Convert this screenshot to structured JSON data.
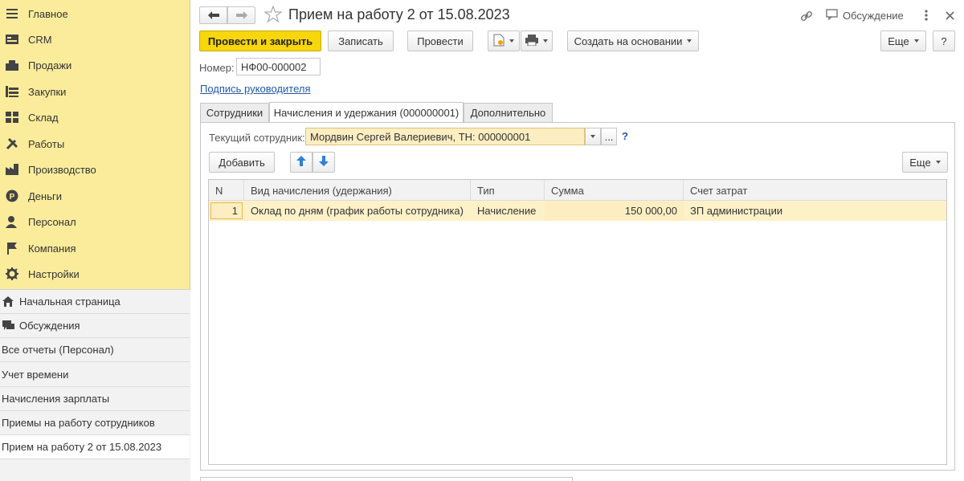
{
  "sidebar": {
    "sections": [
      {
        "label": "Главное",
        "icon": "menu-icon"
      },
      {
        "label": "CRM",
        "icon": "crm-icon"
      },
      {
        "label": "Продажи",
        "icon": "sales-icon"
      },
      {
        "label": "Закупки",
        "icon": "purchases-icon"
      },
      {
        "label": "Склад",
        "icon": "warehouse-icon"
      },
      {
        "label": "Работы",
        "icon": "tools-icon"
      },
      {
        "label": "Производство",
        "icon": "production-icon"
      },
      {
        "label": "Деньги",
        "icon": "money-icon"
      },
      {
        "label": "Персонал",
        "icon": "personnel-icon"
      },
      {
        "label": "Компания",
        "icon": "flag-icon"
      },
      {
        "label": "Настройки",
        "icon": "gear-icon"
      }
    ],
    "nav": [
      {
        "label": "Начальная страница",
        "icon": "home-icon"
      },
      {
        "label": "Обсуждения",
        "icon": "chat-icon"
      },
      {
        "label": "Все отчеты (Персонал)",
        "icon": ""
      },
      {
        "label": "Учет времени",
        "icon": ""
      },
      {
        "label": "Начисления зарплаты",
        "icon": ""
      },
      {
        "label": "Приемы на работу сотрудников",
        "icon": ""
      },
      {
        "label": "Прием на работу 2 от 15.08.2023",
        "icon": ""
      }
    ]
  },
  "header": {
    "title": "Прием на работу 2 от 15.08.2023",
    "discussion_label": "Обсуждение"
  },
  "toolbar": {
    "post_close": "Провести и закрыть",
    "write": "Записать",
    "post": "Провести",
    "create_based": "Создать на основании",
    "more": "Еще",
    "help": "?"
  },
  "form": {
    "number_label": "Номер:",
    "number_value": "НФ00-000002",
    "signature_link": "Подпись руководителя"
  },
  "tabs": [
    {
      "label": "Сотрудники"
    },
    {
      "label": "Начисления и удержания (000000001)"
    },
    {
      "label": "Дополнительно"
    }
  ],
  "panel": {
    "employee_label": "Текущий сотрудник:",
    "employee_value": "Мордвин Сергей Валериевич, ТН: 000000001",
    "dots": "...",
    "help": "?",
    "add": "Добавить",
    "more": "Еще"
  },
  "table": {
    "columns": [
      "N",
      "Вид начисления (удержания)",
      "Тип",
      "Сумма",
      "Счет затрат"
    ],
    "rows": [
      {
        "n": "1",
        "kind": "Оклад по дням (график работы сотрудника)",
        "type": "Начисление",
        "sum": "150 000,00",
        "account": "ЗП администрации"
      }
    ]
  },
  "colors": {
    "sidebar_bg": "#fbec9c",
    "primary": "#f7d60b",
    "row_highlight": "#fdf1c8",
    "link": "#2358a8"
  }
}
